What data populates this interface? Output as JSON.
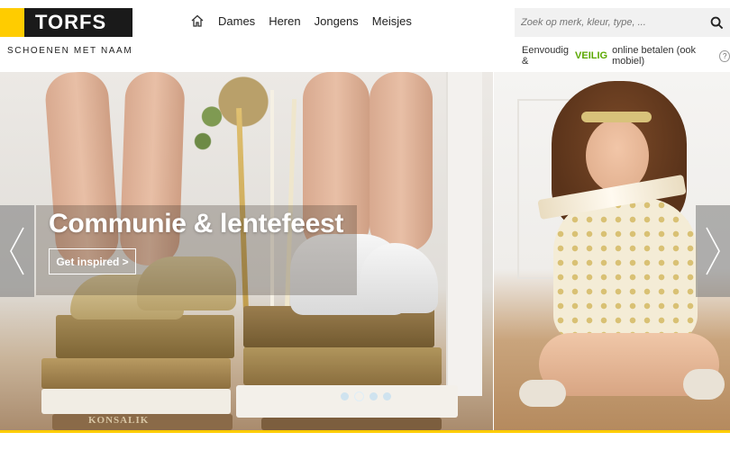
{
  "brand": {
    "name": "TORFS",
    "tagline": "SCHOENEN MET NAAM",
    "accent_color": "#ffcc00",
    "logo_bg": "#1a1a1a"
  },
  "nav": {
    "home_icon": "home-icon",
    "items": [
      "Dames",
      "Heren",
      "Jongens",
      "Meisjes"
    ]
  },
  "search": {
    "placeholder": "Zoek op merk, kleur, type, ...",
    "icon": "search-icon"
  },
  "payment": {
    "text_before": "Eenvoudig &",
    "highlight": "VEILIG",
    "text_after": "online betalen (ook mobiel)",
    "highlight_color": "#5ba800",
    "help_label": "?"
  },
  "hero": {
    "title": "Communie & lentefeest",
    "button_label": "Get inspired >",
    "book_text": "KONSALIK",
    "slide_count": 4,
    "active_slide": 2
  }
}
